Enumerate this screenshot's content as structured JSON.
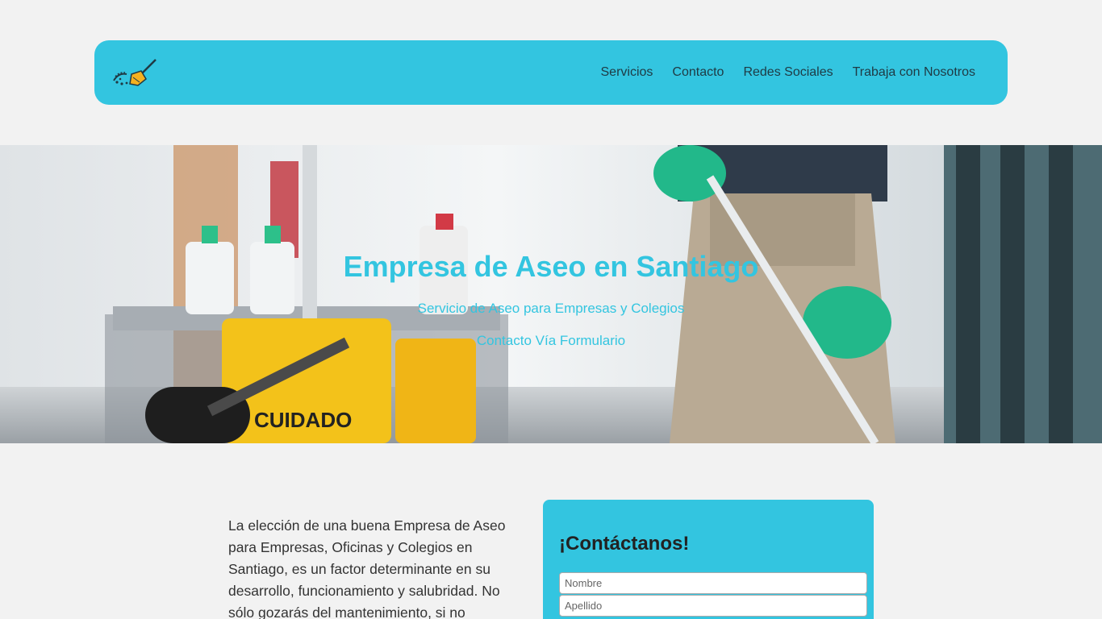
{
  "nav": {
    "logo_icon": "broom-icon",
    "links": [
      "Servicios",
      "Contacto",
      "Redes Sociales",
      "Trabaja con Nosotros"
    ]
  },
  "hero": {
    "title": "Empresa de Aseo en Santiago",
    "subtitle": "Servicio de Aseo para Empresas y Colegios",
    "link": "Contacto Vía Formulario",
    "sign_text": "CUIDADO"
  },
  "intro": {
    "text": "La elección de una buena Empresa de Aseo para Empresas, Oficinas y Colegios en Santiago, es un factor determinante en su desarrollo, funcionamiento y salubridad. No sólo gozarás del mantenimiento, si no"
  },
  "contact": {
    "title": "¡Contáctanos!",
    "nombre_placeholder": "Nombre",
    "apellido_placeholder": "Apellido"
  },
  "colors": {
    "accent": "#33c5e0",
    "background": "#f2f2f2"
  }
}
